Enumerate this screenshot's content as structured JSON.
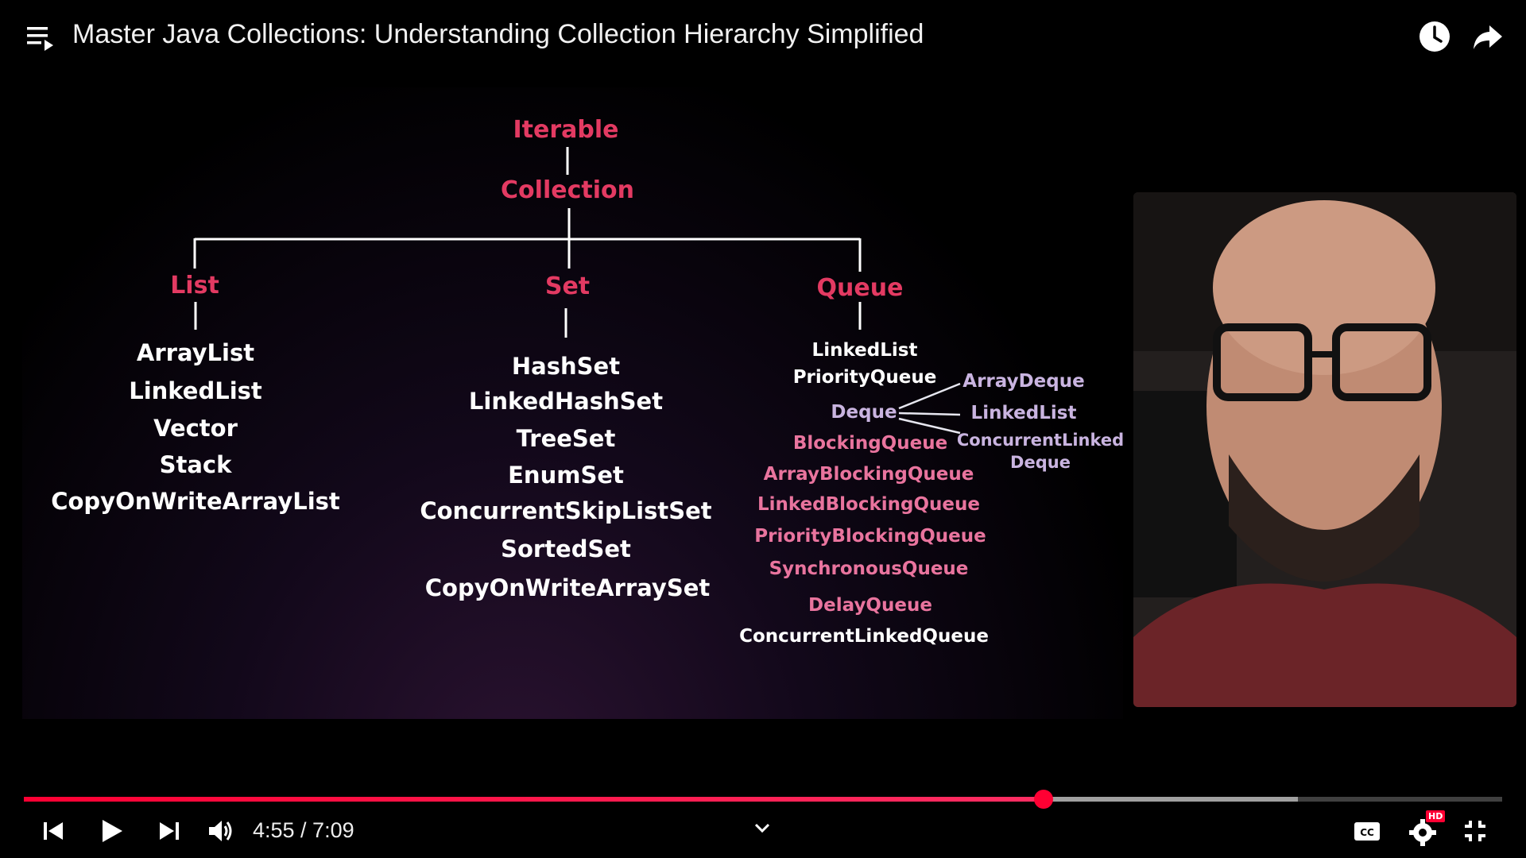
{
  "header": {
    "title": "Master Java Collections: Understanding Collection Hierarchy Simplified",
    "icons": [
      "playlist-icon",
      "watch-later-icon",
      "share-icon"
    ]
  },
  "diagram": {
    "root": "Iterable",
    "collection": "Collection",
    "list": {
      "label": "List",
      "items": [
        "ArrayList",
        "LinkedList",
        "Vector",
        "Stack",
        "CopyOnWriteArrayList"
      ]
    },
    "set": {
      "label": "Set",
      "items": [
        "HashSet",
        "LinkedHashSet",
        "TreeSet",
        "EnumSet",
        "ConcurrentSkipListSet",
        "SortedSet",
        "CopyOnWriteArraySet"
      ]
    },
    "queue": {
      "label": "Queue",
      "items": [
        "LinkedList",
        "PriorityQueue"
      ],
      "deque": {
        "label": "Deque",
        "items": [
          "ArrayDeque",
          "LinkedList",
          "ConcurrentLinked",
          "Deque"
        ]
      },
      "blocking": {
        "label": "BlockingQueue",
        "items": [
          "ArrayBlockingQueue",
          "LinkedBlockingQueue",
          "PriorityBlockingQueue",
          "SynchronousQueue"
        ]
      },
      "more": [
        "DelayQueue",
        "ConcurrentLinkedQueue"
      ]
    }
  },
  "player": {
    "time": "4:55 / 7:09",
    "played_fraction": 0.69,
    "buffered_fraction": 0.862,
    "hd_badge": "HD",
    "controls": [
      "previous-icon",
      "play-icon",
      "next-icon",
      "volume-icon",
      "chevron-down-icon",
      "captions-icon",
      "settings-icon",
      "exit-fullscreen-icon"
    ]
  },
  "colors": {
    "accent": "#ff0033",
    "diagram_red": "#e33a62",
    "diagram_lavender": "#c9b4e0",
    "diagram_pink": "#e9749e"
  }
}
